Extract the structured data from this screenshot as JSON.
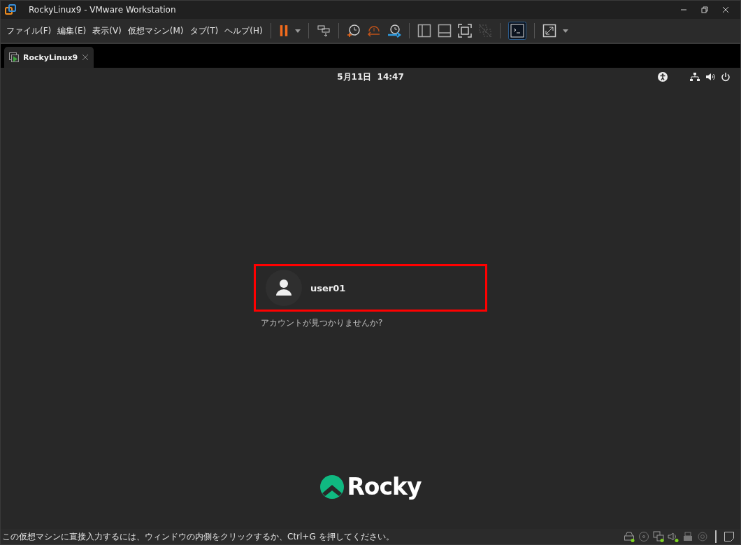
{
  "window": {
    "title": "RockyLinux9 - VMware Workstation"
  },
  "menu": [
    "ファイル(F)",
    "編集(E)",
    "表示(V)",
    "仮想マシン(M)",
    "タブ(T)",
    "ヘルプ(H)"
  ],
  "tabs": [
    {
      "label": "RockyLinux9",
      "selected": true
    }
  ],
  "vm_screen": {
    "clock": "5月11日  14:47",
    "user": {
      "name": "user01",
      "highlighted": true
    },
    "not_listed": "アカウントが見つかりませんか?",
    "logo_text": "Rocky"
  },
  "status_bar": {
    "message": "この仮想マシンに直接入力するには、ウィンドウの内側をクリックするか、Ctrl+G を押してください。",
    "devices": [
      {
        "kind": "disk",
        "active": true
      },
      {
        "kind": "cd",
        "active": false
      },
      {
        "kind": "network",
        "active": true
      },
      {
        "kind": "sound",
        "active": true
      },
      {
        "kind": "usb",
        "active": false
      },
      {
        "kind": "camera",
        "active": false
      }
    ]
  }
}
